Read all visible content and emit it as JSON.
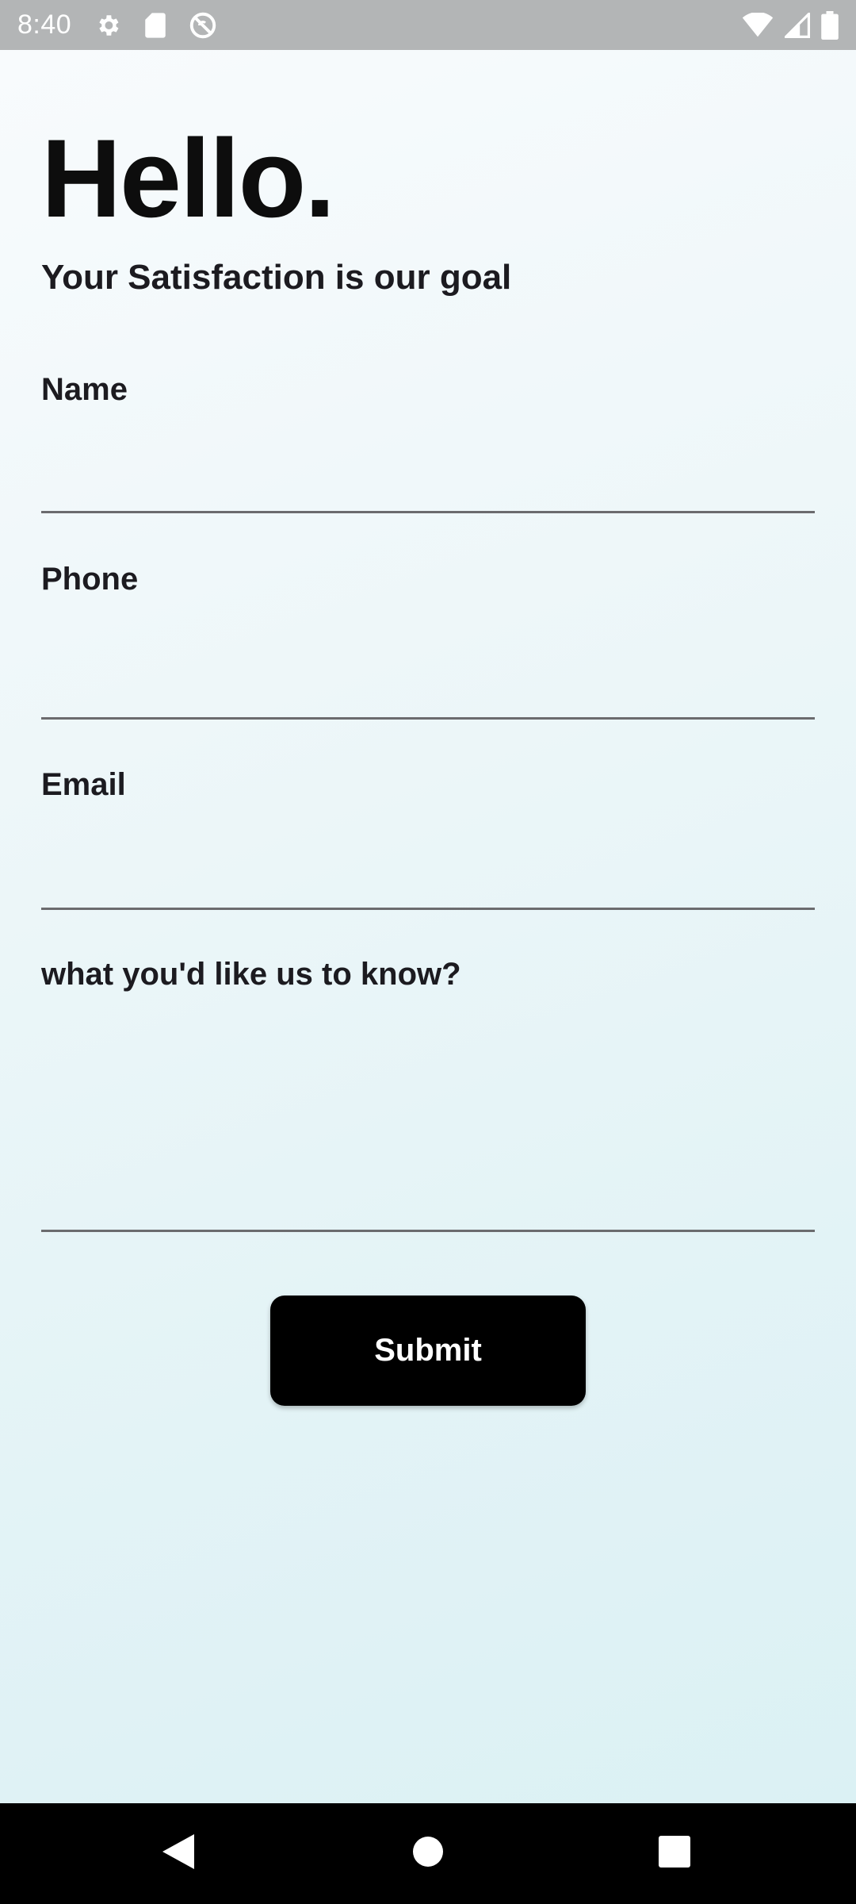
{
  "status_bar": {
    "time": "8:40",
    "left_icons": [
      "gear-icon",
      "sd-card-icon",
      "no-sync-icon"
    ],
    "right_icons": [
      "wifi-icon",
      "signal-icon",
      "battery-icon"
    ]
  },
  "page": {
    "title": "Hello.",
    "subtitle": "Your Satisfaction is our goal"
  },
  "form": {
    "name_label": "Name",
    "name_value": "",
    "phone_label": "Phone",
    "phone_value": "",
    "email_label": "Email",
    "email_value": "",
    "message_label": "what you'd like us to know?",
    "message_value": "",
    "submit_label": "Submit"
  },
  "nav_bar": {
    "buttons": [
      "back-icon",
      "home-icon",
      "recents-icon"
    ]
  },
  "colors": {
    "status_bar_bg": "#b3b5b6",
    "button_bg": "#000000",
    "background_top": "#f8fbfd",
    "background_bottom": "#dbf1f4"
  }
}
